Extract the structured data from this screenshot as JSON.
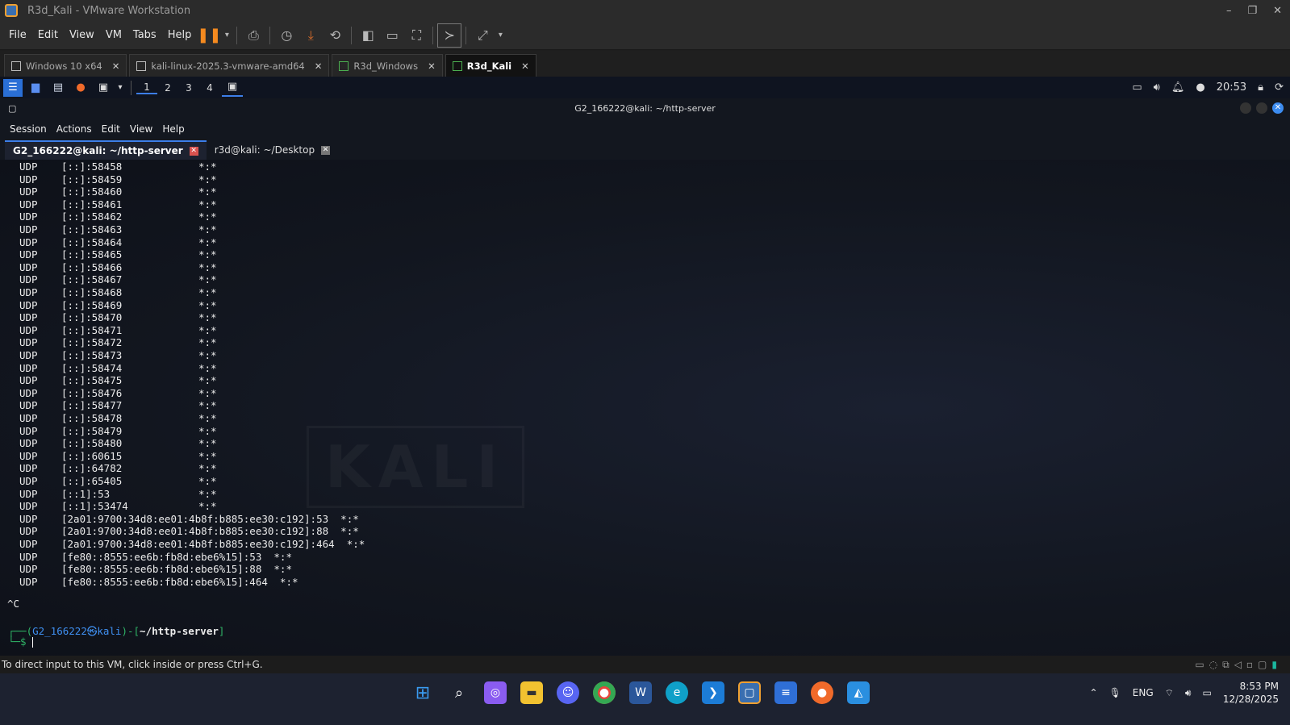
{
  "window": {
    "title": "R3d_Kali - VMware Workstation",
    "buttons": [
      "–",
      "❐",
      "✕"
    ]
  },
  "vmware_menu": [
    "File",
    "Edit",
    "View",
    "VM",
    "Tabs",
    "Help"
  ],
  "vm_tabs": [
    {
      "label": "Windows 10 x64"
    },
    {
      "label": "kali-linux-2025.3-vmware-amd64"
    },
    {
      "label": "R3d_Windows"
    },
    {
      "label": "R3d_Kali"
    }
  ],
  "xfce_panel": {
    "workspaces": [
      "1",
      "2",
      "3",
      "4"
    ],
    "time": "20:53"
  },
  "terminal": {
    "title": "G2_166222@kali: ~/http-server",
    "menu": [
      "Session",
      "Actions",
      "Edit",
      "View",
      "Help"
    ],
    "tabs": [
      {
        "label": "G2_166222@kali: ~/http-server"
      },
      {
        "label": "r3d@kali: ~/Desktop"
      }
    ],
    "rows": [
      {
        "proto": "UDP",
        "local": "[::]:58458",
        "foreign": "*:*"
      },
      {
        "proto": "UDP",
        "local": "[::]:58459",
        "foreign": "*:*"
      },
      {
        "proto": "UDP",
        "local": "[::]:58460",
        "foreign": "*:*"
      },
      {
        "proto": "UDP",
        "local": "[::]:58461",
        "foreign": "*:*"
      },
      {
        "proto": "UDP",
        "local": "[::]:58462",
        "foreign": "*:*"
      },
      {
        "proto": "UDP",
        "local": "[::]:58463",
        "foreign": "*:*"
      },
      {
        "proto": "UDP",
        "local": "[::]:58464",
        "foreign": "*:*"
      },
      {
        "proto": "UDP",
        "local": "[::]:58465",
        "foreign": "*:*"
      },
      {
        "proto": "UDP",
        "local": "[::]:58466",
        "foreign": "*:*"
      },
      {
        "proto": "UDP",
        "local": "[::]:58467",
        "foreign": "*:*"
      },
      {
        "proto": "UDP",
        "local": "[::]:58468",
        "foreign": "*:*"
      },
      {
        "proto": "UDP",
        "local": "[::]:58469",
        "foreign": "*:*"
      },
      {
        "proto": "UDP",
        "local": "[::]:58470",
        "foreign": "*:*"
      },
      {
        "proto": "UDP",
        "local": "[::]:58471",
        "foreign": "*:*"
      },
      {
        "proto": "UDP",
        "local": "[::]:58472",
        "foreign": "*:*"
      },
      {
        "proto": "UDP",
        "local": "[::]:58473",
        "foreign": "*:*"
      },
      {
        "proto": "UDP",
        "local": "[::]:58474",
        "foreign": "*:*"
      },
      {
        "proto": "UDP",
        "local": "[::]:58475",
        "foreign": "*:*"
      },
      {
        "proto": "UDP",
        "local": "[::]:58476",
        "foreign": "*:*"
      },
      {
        "proto": "UDP",
        "local": "[::]:58477",
        "foreign": "*:*"
      },
      {
        "proto": "UDP",
        "local": "[::]:58478",
        "foreign": "*:*"
      },
      {
        "proto": "UDP",
        "local": "[::]:58479",
        "foreign": "*:*"
      },
      {
        "proto": "UDP",
        "local": "[::]:58480",
        "foreign": "*:*"
      },
      {
        "proto": "UDP",
        "local": "[::]:60615",
        "foreign": "*:*"
      },
      {
        "proto": "UDP",
        "local": "[::]:64782",
        "foreign": "*:*"
      },
      {
        "proto": "UDP",
        "local": "[::]:65405",
        "foreign": "*:*"
      },
      {
        "proto": "UDP",
        "local": "[::1]:53",
        "foreign": "*:*"
      },
      {
        "proto": "UDP",
        "local": "[::1]:53474",
        "foreign": "*:*"
      }
    ],
    "long_rows": [
      {
        "proto": "UDP",
        "text": "[2a01:9700:34d8:ee01:4b8f:b885:ee30:c192]:53  *:*"
      },
      {
        "proto": "UDP",
        "text": "[2a01:9700:34d8:ee01:4b8f:b885:ee30:c192]:88  *:*"
      },
      {
        "proto": "UDP",
        "text": "[2a01:9700:34d8:ee01:4b8f:b885:ee30:c192]:464  *:*"
      },
      {
        "proto": "UDP",
        "text": "[fe80::8555:ee6b:fb8d:ebe6%15]:53  *:*"
      },
      {
        "proto": "UDP",
        "text": "[fe80::8555:ee6b:fb8d:ebe6%15]:88  *:*"
      },
      {
        "proto": "UDP",
        "text": "[fe80::8555:ee6b:fb8d:ebe6%15]:464  *:*"
      }
    ],
    "ctrl_c": "^C",
    "prompt": {
      "open": "┌──(",
      "user": "G2_166222",
      "at": "㉿",
      "host": "kali",
      "mid": ")-[",
      "path": "~/http-server",
      "close": "]",
      "second": "└─$"
    },
    "watermark": "KALI"
  },
  "status_bar": "To direct input to this VM, click inside or press Ctrl+G.",
  "taskbar": {
    "language": "ENG",
    "time": "8:53 PM",
    "date": "12/28/2025"
  }
}
